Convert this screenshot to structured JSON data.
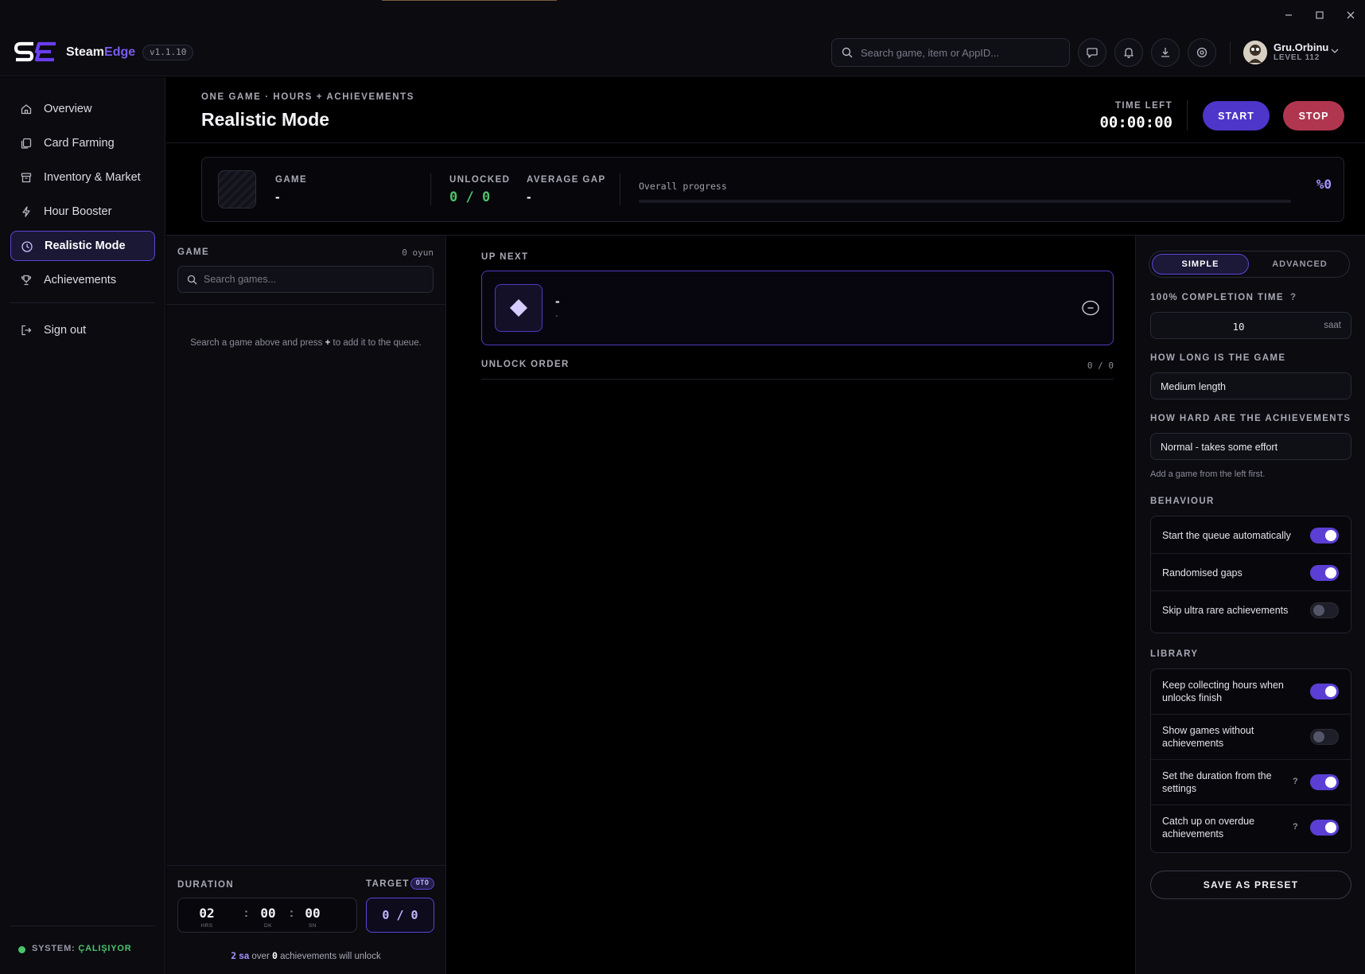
{
  "app": {
    "name_main": "Steam",
    "name_accent": "Edge",
    "version": "v1.1.10"
  },
  "header": {
    "search_placeholder": "Search game, item or AppID...",
    "user": {
      "name": "Gru.Orbinu",
      "level": "LEVEL 112"
    }
  },
  "sidebar": {
    "items": [
      {
        "label": "Overview",
        "icon": "home-icon"
      },
      {
        "label": "Card Farming",
        "icon": "cards-icon"
      },
      {
        "label": "Inventory & Market",
        "icon": "box-icon"
      },
      {
        "label": "Hour Booster",
        "icon": "bolt-icon"
      },
      {
        "label": "Realistic Mode",
        "icon": "clock-icon",
        "active": true
      },
      {
        "label": "Achievements",
        "icon": "trophy-icon"
      }
    ],
    "signout": "Sign out",
    "system_label": "SYSTEM:",
    "system_status": "ÇALIŞIYOR"
  },
  "page": {
    "breadcrumb": "ONE GAME · HOURS + ACHIEVEMENTS",
    "title": "Realistic Mode",
    "time_left_label": "TIME LEFT",
    "time_left": "00:00:00",
    "start": "START",
    "stop": "STOP"
  },
  "stats": {
    "game_label": "GAME",
    "game_value": "-",
    "unlocked_label": "UNLOCKED",
    "unlocked_value": "0 / 0",
    "avg_gap_label": "AVERAGE GAP",
    "avg_gap_value": "-",
    "overall_label": "Overall progress",
    "overall_value": "%0",
    "overall_progress": 0
  },
  "games": {
    "label": "GAME",
    "count": "0 oyun",
    "search_placeholder": "Search games...",
    "empty_prefix": "Search a game above and press ",
    "empty_key": "+",
    "empty_suffix": " to add it to the queue."
  },
  "duration": {
    "label": "DURATION",
    "hours": "02",
    "hours_unit": "HRS",
    "minutes": "00",
    "minutes_unit": "DK",
    "seconds": "00",
    "seconds_unit": "SN",
    "target_label": "TARGET",
    "target_badge": "OTO",
    "target_value": "0 / 0",
    "summary_num": "2",
    "summary_unit": " sa",
    "summary_mid": " over ",
    "summary_count": "0",
    "summary_end": " achievements will unlock"
  },
  "upnext": {
    "label": "UP NEXT",
    "title": "-",
    "subtitle": "-",
    "order_label": "UNLOCK ORDER",
    "order_count": "0 / 0"
  },
  "settings": {
    "mode_simple": "SIMPLE",
    "mode_advanced": "ADVANCED",
    "completion_label": "100% COMPLETION TIME",
    "completion_help": "?",
    "completion_value": "10",
    "completion_unit": "saat",
    "length_label": "HOW LONG IS THE GAME",
    "length_value": "Medium length",
    "difficulty_label": "HOW HARD ARE THE ACHIEVEMENTS",
    "difficulty_value": "Normal - takes some effort",
    "hint": "Add a game from the left first.",
    "behaviour_label": "BEHAVIOUR",
    "behaviour": [
      {
        "label": "Start the queue automatically",
        "on": true
      },
      {
        "label": "Randomised gaps",
        "on": true
      },
      {
        "label": "Skip ultra rare achievements",
        "on": false
      }
    ],
    "library_label": "LIBRARY",
    "library": [
      {
        "label": "Keep collecting hours when unlocks finish",
        "on": true
      },
      {
        "label": "Show games without achievements",
        "on": false
      },
      {
        "label": "Set the duration from the settings",
        "on": true,
        "help": "?"
      },
      {
        "label": "Catch up on overdue achievements",
        "on": true,
        "help": "?"
      }
    ],
    "save": "SAVE AS PRESET"
  }
}
